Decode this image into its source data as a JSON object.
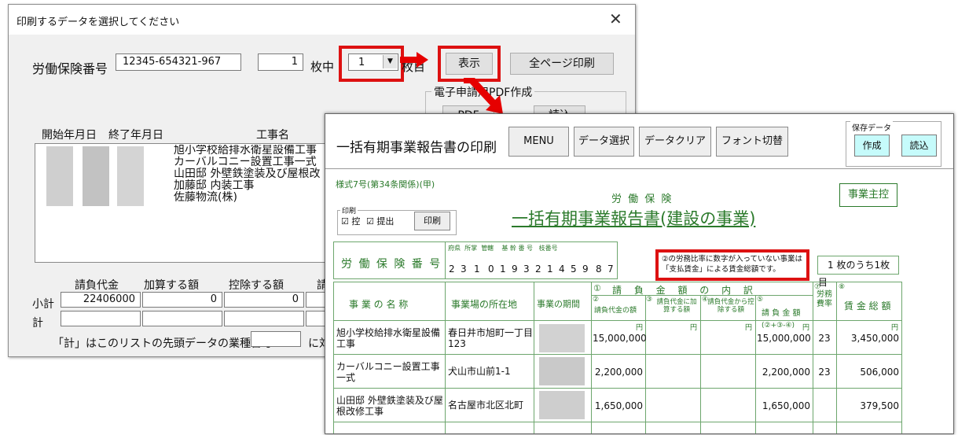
{
  "dialog": {
    "title": "印刷するデータを選択してください",
    "close_glyph": "✕",
    "insurance_label": "労働保険番号",
    "insurance_number": "12345-654321-967",
    "sheet_count": "1",
    "sheet_unit": "枚中",
    "sheet_select": "1",
    "sheet_suffix": "枚目",
    "show_button": "表示",
    "print_all_button": "全ページ印刷",
    "pdf_group_label": "電子申請用PDF作成",
    "pdf_button": "PDF",
    "read_button": "読込",
    "list_headers": {
      "start": "開始年月日",
      "end": "終了年月日",
      "work": "工事名"
    },
    "list_items": [
      "旭小学校給排水衛星設備工事",
      "カーバルコニー設置工事一式",
      "山田邸 外壁鉄塗装及び屋根改",
      "加藤邸 内装工事",
      "佐藤物流(株)"
    ],
    "sum_headers": {
      "contract": "請負代金",
      "add": "加算する額",
      "deduct": "控除する額",
      "partial": "請"
    },
    "subtotal_label": "小計",
    "subtotal_contract": "22406000",
    "subtotal_add": "0",
    "subtotal_deduct": "0",
    "total_label": "計",
    "footnote": "「計」はこのリストの先頭データの業種番号",
    "footnote_tail": "に対"
  },
  "panel": {
    "title": "一括有期事業報告書の印刷",
    "toolbar": [
      "MENU",
      "データ選択",
      "データクリア",
      "フォント切替"
    ],
    "save_group_label": "保存データ",
    "create_button": "作成",
    "load_button": "読込",
    "form": {
      "form_no": "様式7号(第34条関係)(甲)",
      "heading_small": "労 働 保 険",
      "heading_main": "一括有期事業報告書(建設の事業)",
      "owner_badge": "事業主控",
      "print_group_label": "印刷",
      "check_copy": "控",
      "check_submit": "提出",
      "print_button": "印刷",
      "insurance_label": "労 働 保 険 番 号",
      "digit_headers": [
        "府県",
        "所掌",
        "管轄",
        "基 幹 番 号",
        "枝番号"
      ],
      "digits": [
        "2",
        "3",
        "1",
        "0",
        "1",
        "9",
        "3",
        "2",
        "1",
        "4",
        "5",
        "9",
        "8",
        "7"
      ],
      "note_line1": "②の労務比率に数字が入っていない事業は",
      "note_line2": "「支払賃金」による賃金総額です。",
      "page_info_num": "1",
      "page_info_text": "枚のうち1枚目",
      "col_project": "事 業 の 名 称",
      "col_location": "事業場の所在地",
      "col_period": "事業の期間",
      "col_breakdown_num": "①",
      "col_breakdown": "請 負 金 額 の 内 訳",
      "sub_contract_num": "②",
      "sub_contract": "請負代金の額",
      "sub_add_num": "③",
      "sub_add": "請負代金に加算する額",
      "sub_deduct_num": "④",
      "sub_deduct": "請負代金から控除する額",
      "sub_total_num": "⑤",
      "sub_total": "請 負 金 額",
      "col_rate_num": "⑦",
      "col_rate": "労務費率",
      "col_wage_num": "⑧",
      "col_wage": "賃 金 総 額",
      "yen": "円",
      "formula": "(②+③-④)",
      "rows": [
        {
          "name": "旭小学校給排水衛星設備工事",
          "location": "春日井市旭町一丁目123",
          "contract": "15,000,000",
          "total": "15,000,000",
          "rate": "23",
          "wage": "3,450,000"
        },
        {
          "name": "カーバルコニー設置工事一式",
          "location": "犬山市山前1-1",
          "contract": "2,200,000",
          "total": "2,200,000",
          "rate": "23",
          "wage": "506,000"
        },
        {
          "name": "山田邸 外壁鉄塗装及び屋根改修工事",
          "location": "名古屋市北区北町",
          "contract": "1,650,000",
          "total": "1,650,000",
          "rate": "",
          "wage": "379,500"
        }
      ]
    }
  },
  "colors": {
    "highlight_red": "#d11",
    "form_green": "#2b7a2b",
    "cyan_button": "#c6fbfb"
  },
  "icons": {
    "close": "close-icon",
    "dropdown": "dropdown-arrow-icon",
    "arrow": "red-arrow-icon"
  }
}
